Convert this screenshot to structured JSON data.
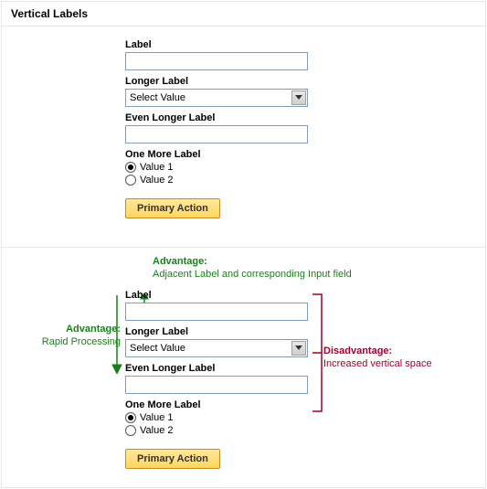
{
  "header": {
    "title": "Vertical Labels"
  },
  "form": {
    "f1": {
      "label": "Label",
      "value": ""
    },
    "f2": {
      "label": "Longer Label",
      "selected": "Select Value"
    },
    "f3": {
      "label": "Even Longer Label",
      "value": ""
    },
    "f4": {
      "label": "One More Label",
      "opt1": "Value 1",
      "opt2": "Value 2"
    },
    "primary": "Primary Action"
  },
  "annotations": {
    "top": {
      "title": "Advantage:",
      "text": "Adjacent Label and corresponding Input field"
    },
    "left": {
      "title": "Advantage:",
      "text": "Rapid Processing"
    },
    "right": {
      "title": "Disadvantage:",
      "text": "Increased vertical space"
    }
  }
}
